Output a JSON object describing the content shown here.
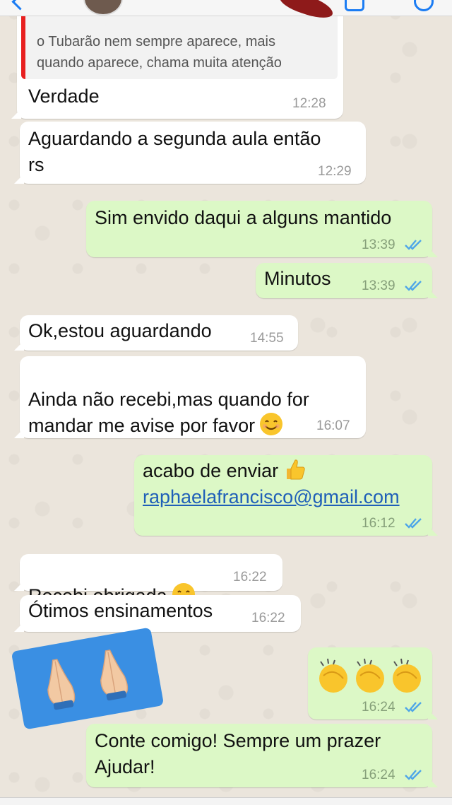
{
  "quoted": {
    "text": "o Tubarão nem sempre aparece, mais\nquando aparece, chama muita atenção"
  },
  "messages": [
    {
      "dir": "in",
      "text": "Verdade",
      "time": "12:28"
    },
    {
      "dir": "in",
      "text": "Aguardando a segunda aula então\nrs",
      "time": "12:29"
    },
    {
      "dir": "out",
      "text": "Sim envido daqui a alguns mantido",
      "time": "13:39"
    },
    {
      "dir": "out",
      "text": "Minutos",
      "time": "13:39"
    },
    {
      "dir": "in",
      "text": "Ok,estou aguardando",
      "time": "14:55"
    },
    {
      "dir": "in",
      "text": "Ainda não recebi,mas quando for\nmandar me avise por favor",
      "time": "16:07",
      "emoji": "smile-icon"
    },
    {
      "dir": "out",
      "text": "acabo de enviar",
      "link": "raphaelafrancisco@gmail.com",
      "time": "16:12",
      "emoji": "thumbs-up-icon"
    },
    {
      "dir": "in",
      "text": "Recebi,obrigada",
      "time": "16:22",
      "emoji": "smile-icon"
    },
    {
      "dir": "in",
      "text": "Ótimos ensinamentos",
      "time": "16:22"
    },
    {
      "dir": "out",
      "text": "",
      "time": "16:24",
      "emoji": "clapping-hands-icon"
    },
    {
      "dir": "out",
      "text": "Conte comigo! Sempre um prazer\nAjudar!",
      "time": "16:24"
    }
  ],
  "colors": {
    "incoming_bubble": "#ffffff",
    "outgoing_bubble": "#dcf8c6",
    "read_ticks": "#4fa6e8",
    "quote_bar": "#e8201f"
  }
}
